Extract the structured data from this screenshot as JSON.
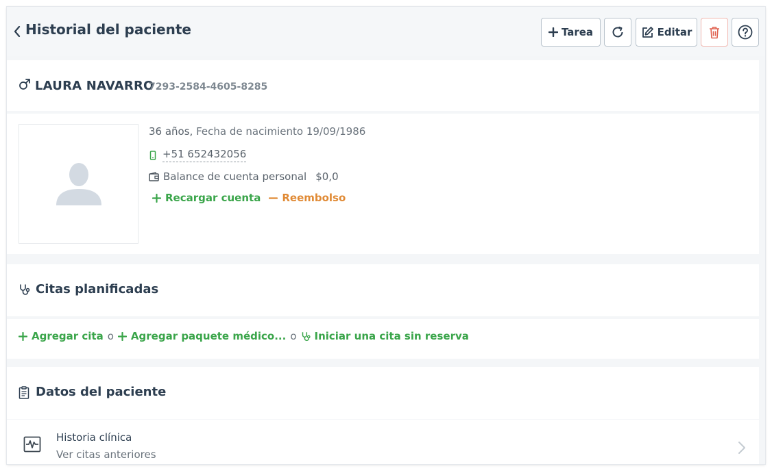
{
  "header": {
    "title": "Historial del paciente",
    "buttons": {
      "task_label": "Tarea",
      "edit_label": "Editar"
    }
  },
  "patient": {
    "name": "LAURA NAVARRO",
    "id": "7293-2584-4605-8285",
    "age": "36 años,",
    "birth": "Fecha de nacimiento 19/09/1986",
    "phone": "+51 652432056",
    "balance_label": "Balance de cuenta personal",
    "balance_value": "$0,0",
    "recharge_label": "Recargar cuenta",
    "refund_label": "Reembolso"
  },
  "appointments": {
    "title": "Citas planificadas",
    "add_label": "Agregar cita",
    "or1": "o",
    "add_package_label": "Agregar paquete médico...",
    "or2": "o",
    "walkin_label": "Iniciar una cita sin reserva"
  },
  "patient_data": {
    "title": "Datos del paciente",
    "history_title": "Historia clínica",
    "history_sub": "Ver citas anteriores"
  },
  "colors": {
    "accent_green": "#3aa54a",
    "accent_orange": "#e08a35",
    "danger": "#e0614f",
    "heading": "#2d3e50"
  }
}
